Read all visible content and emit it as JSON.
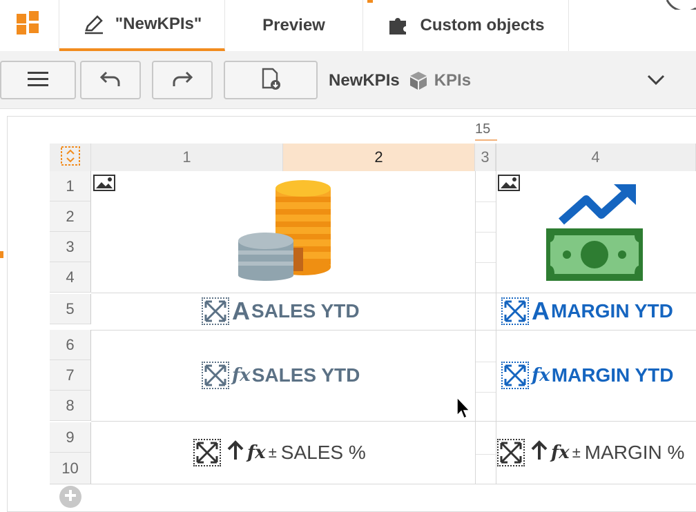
{
  "tabs": [
    {
      "label": "\"NewKPIs\"",
      "icon": "pencil-icon",
      "active": true
    },
    {
      "label": "Preview",
      "icon": "",
      "active": false
    },
    {
      "label": "Custom objects",
      "icon": "puzzle-icon",
      "active": false
    }
  ],
  "toolbar": {
    "breadcrumb_app": "NewKPIs",
    "breadcrumb_sheet": "KPIs"
  },
  "ruler": {
    "marker": "15"
  },
  "grid": {
    "columns": [
      "1",
      "2",
      "3",
      "4"
    ],
    "selected_column": "2",
    "rows": [
      "1",
      "2",
      "3",
      "4",
      "5",
      "6",
      "7",
      "8",
      "9",
      "10"
    ]
  },
  "kpis": {
    "sales_label": "SALES YTD",
    "sales_value": "SALES YTD",
    "sales_pct": "SALES %",
    "margin_label": "MARGIN YTD",
    "margin_value": "MARGIN YTD",
    "margin_pct": "MARGIN %",
    "plus_minus": "±",
    "fx": "fx",
    "label_marker": "A"
  },
  "colors": {
    "accent": "#f28c1e",
    "slate": "#5b7185",
    "blue": "#1565c0"
  }
}
